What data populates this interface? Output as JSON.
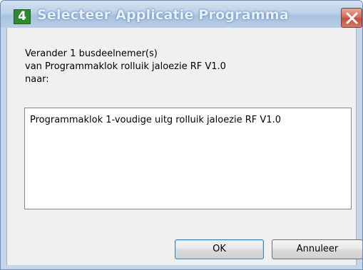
{
  "window": {
    "title": "Selecteer Applicatie Programma",
    "app_icon_glyph": "4",
    "close_icon": "close-icon"
  },
  "message": {
    "line1": "Verander 1 busdeelnemer(s)",
    "line2": "van Programmaklok rolluik jaloezie RF V1.0",
    "line3": "naar:"
  },
  "list": {
    "items": [
      "Programmaklok 1-voudige uitg rolluik jaloezie RF V1.0"
    ]
  },
  "buttons": {
    "ok_label": "OK",
    "cancel_label": "Annuleer"
  },
  "colors": {
    "titlebar": "#bcd1e8",
    "close_button": "#c0503d",
    "client_background": "#f0f0f0",
    "app_icon": "#2e8a2e"
  }
}
